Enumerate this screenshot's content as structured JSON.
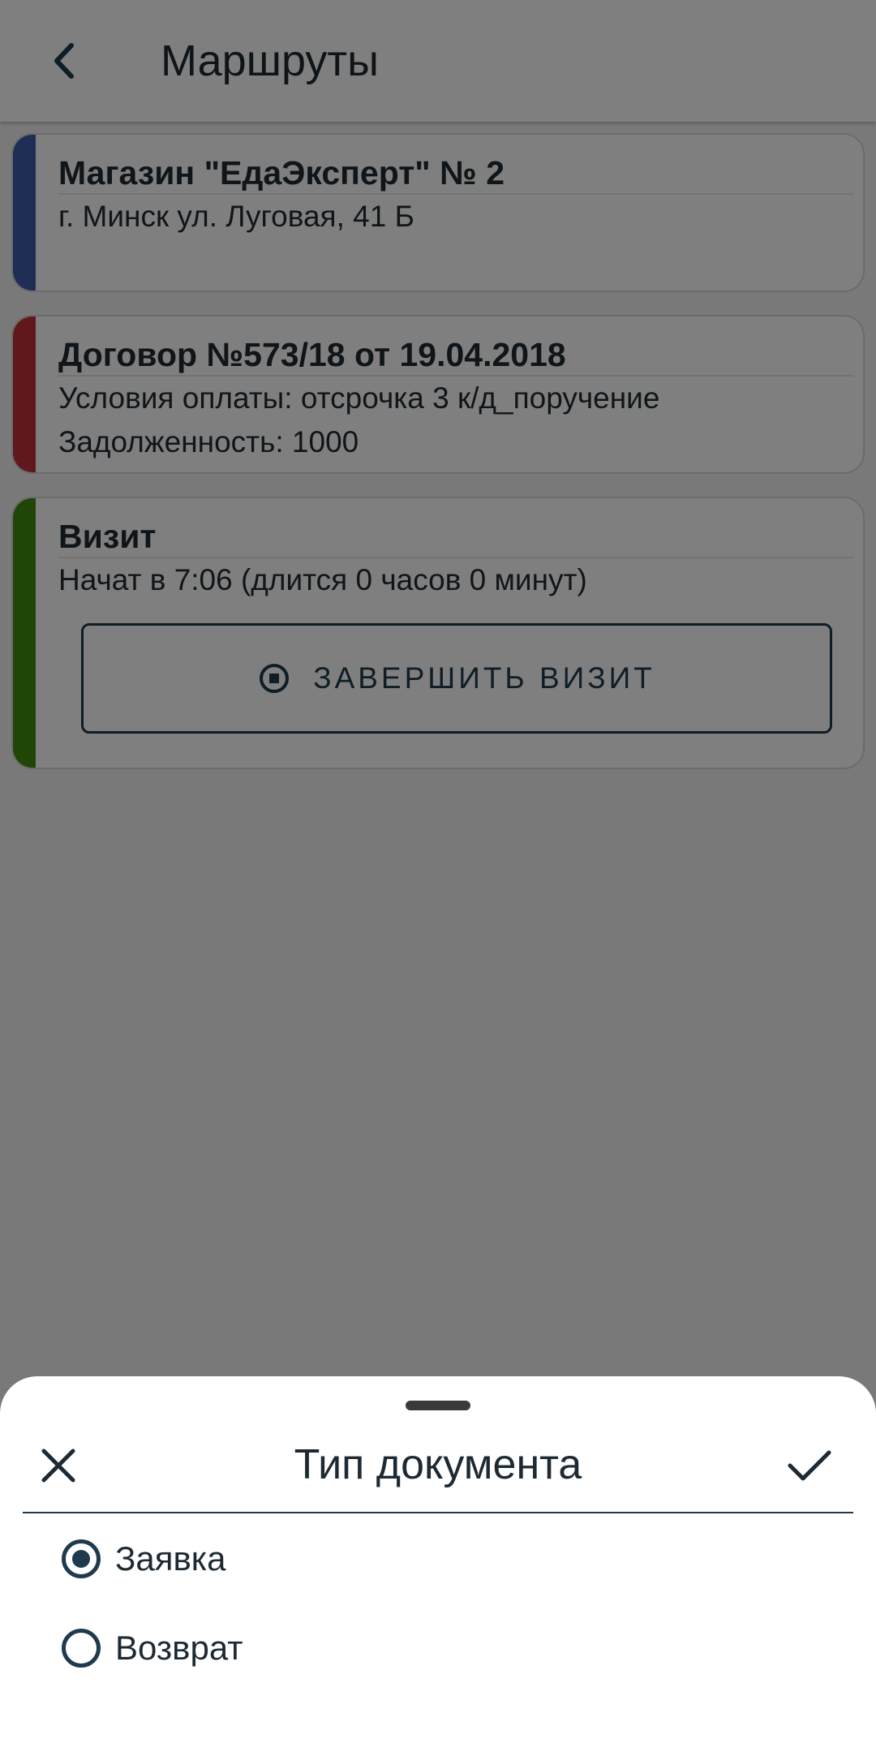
{
  "app_bar": {
    "title": "Маршруты"
  },
  "cards": {
    "store": {
      "title": "Магазин \"ЕдаЭксперт\" № 2",
      "address": "г. Минск ул. Луговая, 41 Б",
      "accent_color": "#3c5ca8"
    },
    "contract": {
      "title": "Договор №573/18 от 19.04.2018",
      "payment_terms": "Условия оплаты: отсрочка 3 к/д_поручение",
      "debt": "Задолженность: 1000",
      "accent_color": "#c0303a"
    },
    "visit": {
      "title": "Визит",
      "started": "Начат в 7:06 (длится 0 часов 0 минут)",
      "finish_button_label": "ЗАВЕРШИТЬ ВИЗИТ",
      "accent_color": "#3f8a0e"
    }
  },
  "sheet": {
    "title": "Тип документа",
    "options": [
      {
        "label": "Заявка",
        "selected": true
      },
      {
        "label": "Возврат",
        "selected": false
      }
    ]
  },
  "colors": {
    "primary": "#1e3a4c",
    "scrim": "rgba(0,0,0,0.5)"
  }
}
